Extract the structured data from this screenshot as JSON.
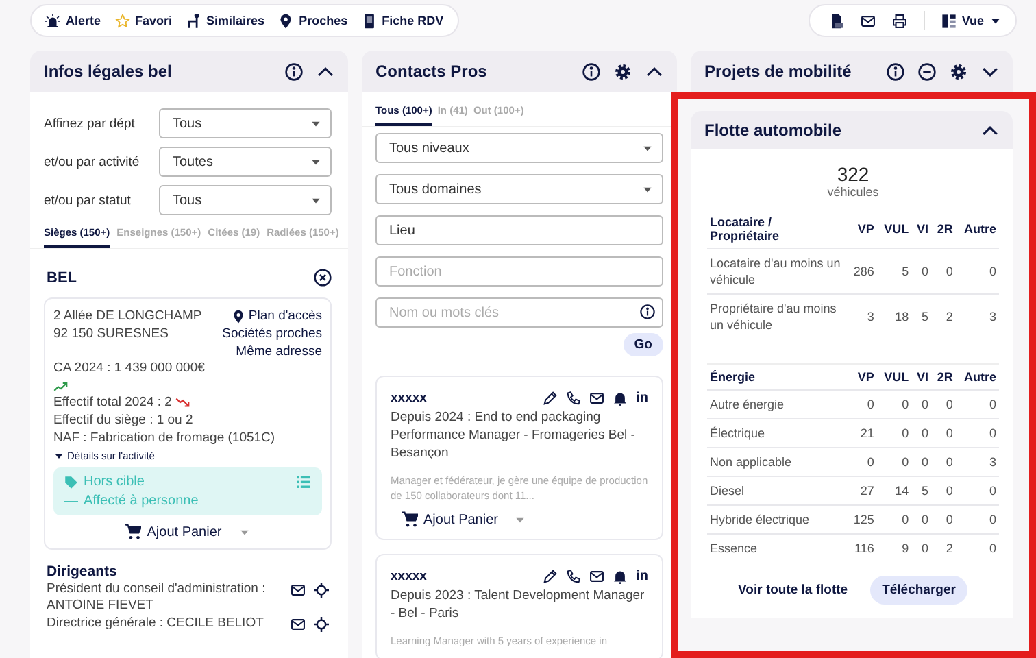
{
  "toolbar": {
    "actions": [
      {
        "kind": "alert",
        "label": "Alerte"
      },
      {
        "kind": "favorite",
        "label": "Favori"
      },
      {
        "kind": "similar",
        "label": "Similaires"
      },
      {
        "kind": "nearby",
        "label": "Proches"
      },
      {
        "kind": "sheet",
        "label": "Fiche RDV"
      }
    ],
    "view_menu": {
      "label": "Vue"
    }
  },
  "legal_panel": {
    "title": "Infos légales bel",
    "expanded": true,
    "filters": [
      {
        "label": "Affinez par dépt",
        "value": "Tous"
      },
      {
        "label": "et/ou par activité",
        "value": "Toutes"
      },
      {
        "label": "et/ou par statut",
        "value": "Tous"
      }
    ],
    "tabs": [
      {
        "label": "Sièges (150+)",
        "selected": true
      },
      {
        "label": "Enseignes (150+)",
        "selected": false
      },
      {
        "label": "Citées (19)",
        "selected": false
      },
      {
        "label": "Radiées (150+)",
        "selected": false
      }
    ],
    "company": {
      "name": "BEL",
      "address": [
        "2 Allée DE LONGCHAMP",
        "92 150 SURESNES"
      ],
      "links": [
        "Plan d'accès",
        "Sociétés proches",
        "Même adresse"
      ],
      "revenue": {
        "text": "CA 2024 : 1 439 000 000€",
        "kind": "rising"
      },
      "facts": [
        {
          "text": "Effectif total 2024 : 2",
          "kind": "falling"
        },
        {
          "text": "Effectif du siège : 1 ou 2",
          "kind": "plain"
        },
        {
          "text": "NAF : Fabrication de fromage (1051C)",
          "kind": "plain"
        }
      ],
      "details_toggle": "Détails sur l'activité",
      "target_status": "Hors cible",
      "assignment": "Affecté à personne",
      "cart": "Ajout Panier"
    },
    "executives": {
      "title": "Dirigeants",
      "people": [
        {
          "role": "Président du conseil d'administration :",
          "name": "ANTOINE FIEVET"
        },
        {
          "role": "Directrice générale :",
          "name": "CECILE BELIOT"
        }
      ]
    }
  },
  "contacts_panel": {
    "title": "Contacts Pros",
    "expanded": true,
    "tabs": [
      {
        "label": "Tous (100+)",
        "selected": true
      },
      {
        "label": "In (41)",
        "selected": false
      },
      {
        "label": "Out (100+)",
        "selected": false
      }
    ],
    "selects": [
      {
        "value": "Tous niveaux"
      },
      {
        "value": "Tous domaines"
      }
    ],
    "fields": [
      {
        "kind": "text",
        "value": "Lieu"
      },
      {
        "kind": "text",
        "placeholder": "Fonction"
      },
      {
        "kind": "search",
        "placeholder": "Nom ou mots clés"
      }
    ],
    "go_button": "Go",
    "contacts": [
      {
        "name": "xxxxx",
        "network": "in",
        "headline": "Depuis 2024 : End to end packaging Performance Manager - Fromageries Bel - Besançon",
        "summary": "Manager et fédérateur, je gère une équipe de production de 150 collaborateurs dont 11...",
        "cart": "Ajout Panier"
      },
      {
        "name": "xxxxx",
        "network": "in",
        "headline": "Depuis 2023 : Talent Development Manager - Bel - Paris",
        "summary": "Learning Manager with 5 years of experience in"
      }
    ]
  },
  "mobility_panel": {
    "title": "Projets de mobilité",
    "expanded": false
  },
  "fleet_panel": {
    "title": "Flotte automobile",
    "expanded": true,
    "total": "322",
    "unit": "véhicules",
    "tables": [
      {
        "columns": [
          "Locataire / Propriétaire",
          "VP",
          "VUL",
          "VI",
          "2R",
          "Autre"
        ],
        "rows": [
          [
            "Locataire d'au moins un véhicule",
            "286",
            "5",
            "0",
            "0",
            "0"
          ],
          [
            "Propriétaire d'au moins un véhicule",
            "3",
            "18",
            "5",
            "2",
            "3"
          ]
        ]
      },
      {
        "columns": [
          "Énergie",
          "VP",
          "VUL",
          "VI",
          "2R",
          "Autre"
        ],
        "rows": [
          [
            "Autre énergie",
            "0",
            "0",
            "0",
            "0",
            "0"
          ],
          [
            "Électrique",
            "21",
            "0",
            "0",
            "0",
            "0"
          ],
          [
            "Non applicable",
            "0",
            "0",
            "0",
            "0",
            "3"
          ],
          [
            "Diesel",
            "27",
            "14",
            "5",
            "0",
            "0"
          ],
          [
            "Hybride électrique",
            "125",
            "0",
            "0",
            "0",
            "0"
          ],
          [
            "Essence",
            "116",
            "9",
            "0",
            "2",
            "0"
          ]
        ]
      }
    ],
    "link": "Voir toute la flotte",
    "download_button": "Télécharger"
  }
}
